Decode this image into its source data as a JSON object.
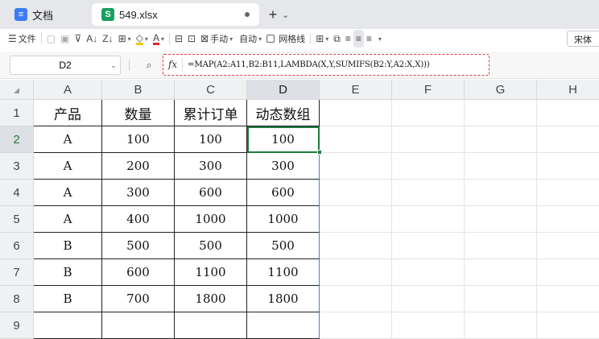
{
  "tabs": {
    "docs_label": "文档",
    "file_label": "549.xlsx",
    "new_tab": "+"
  },
  "toolbar": {
    "menu_label": "文件",
    "wrap_label": "手动",
    "auto_label": "自动",
    "gridline_label": "网格线",
    "font_name": "宋体"
  },
  "formula_bar": {
    "cell_ref": "D2",
    "fx": "fx",
    "formula": "=MAP(A2:A11,B2:B11,LAMBDA(X,Y,SUMIFS(B2:Y,A2:X,X)))"
  },
  "sheet": {
    "columns": [
      "A",
      "B",
      "C",
      "D",
      "E",
      "F",
      "G",
      "H"
    ],
    "row_numbers": [
      "1",
      "2",
      "3",
      "4",
      "5",
      "6",
      "7",
      "8",
      "9"
    ],
    "header": [
      "产品",
      "数量",
      "累计订单",
      "动态数组"
    ],
    "rows": [
      [
        "A",
        "100",
        "100",
        "100"
      ],
      [
        "A",
        "200",
        "300",
        "300"
      ],
      [
        "A",
        "300",
        "600",
        "600"
      ],
      [
        "A",
        "400",
        "1000",
        "1000"
      ],
      [
        "B",
        "500",
        "500",
        "500"
      ],
      [
        "B",
        "600",
        "1100",
        "1100"
      ],
      [
        "B",
        "700",
        "1800",
        "1800"
      ]
    ],
    "active_cell": "D2",
    "selection_color": "#1e7a3a",
    "spill_border_color": "#4a7fd3"
  }
}
